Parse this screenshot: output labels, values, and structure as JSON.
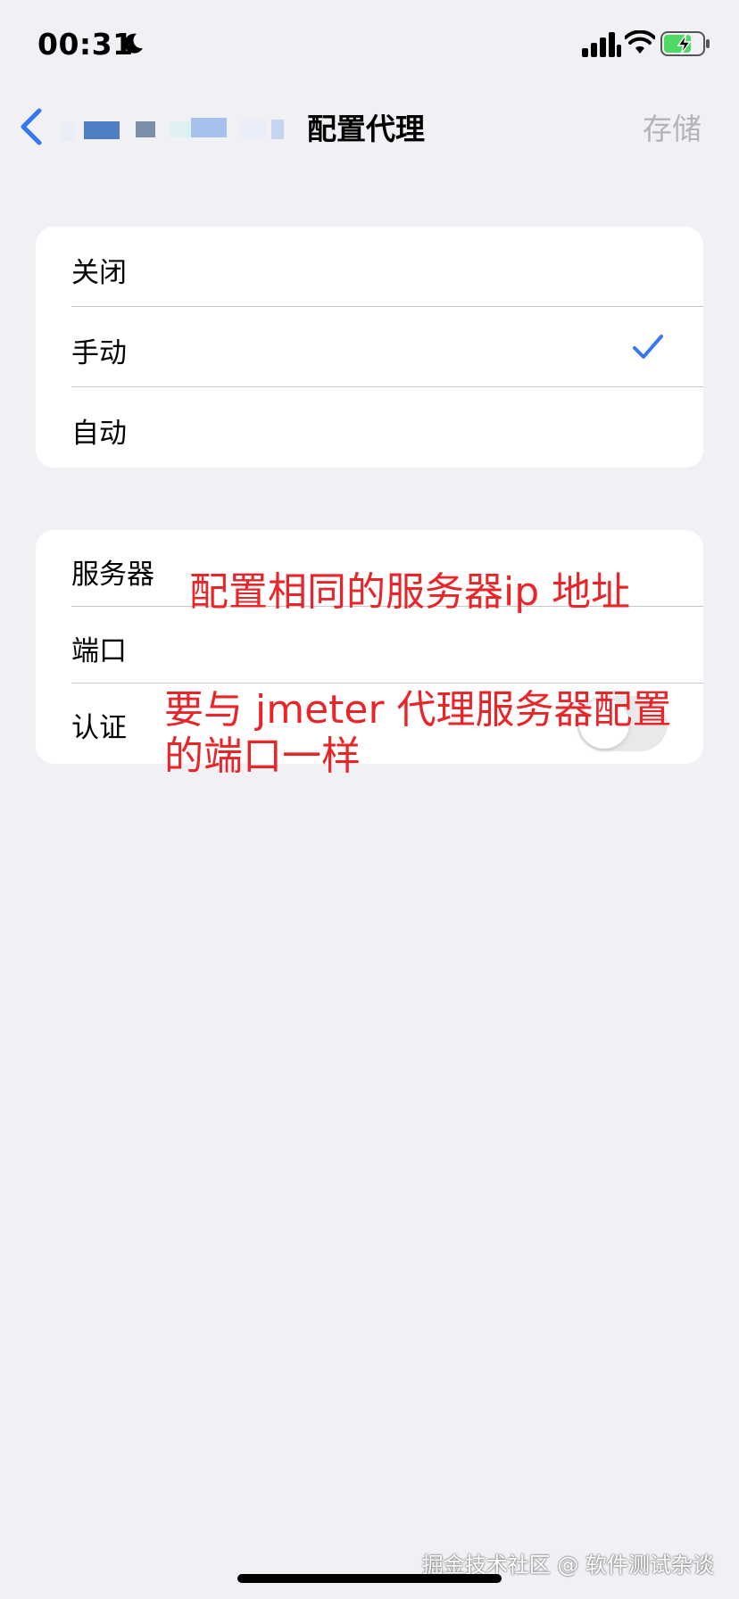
{
  "status_bar": {
    "time": "00:31",
    "icons": [
      "moon-icon",
      "signal-icon",
      "wifi-icon",
      "battery-charging-icon"
    ],
    "battery_color": "#4cd964"
  },
  "nav": {
    "back_icon": "chevron-left-icon",
    "title": "配置代理",
    "save_label": "存储",
    "accent_color": "#3478f6"
  },
  "mode_options": [
    {
      "label": "关闭",
      "selected": false
    },
    {
      "label": "手动",
      "selected": true
    },
    {
      "label": "自动",
      "selected": false
    }
  ],
  "config_rows": {
    "server_label": "服务器",
    "port_label": "端口",
    "auth_label": "认证",
    "auth_enabled": false
  },
  "annotations": {
    "server_note": "配置相同的服务器ip 地址",
    "port_note": "要与 jmeter 代理服务器配置\n的端口一样",
    "color": "#e8262a"
  },
  "watermark": "掘金技术社区 @ 软件测试杂谈"
}
